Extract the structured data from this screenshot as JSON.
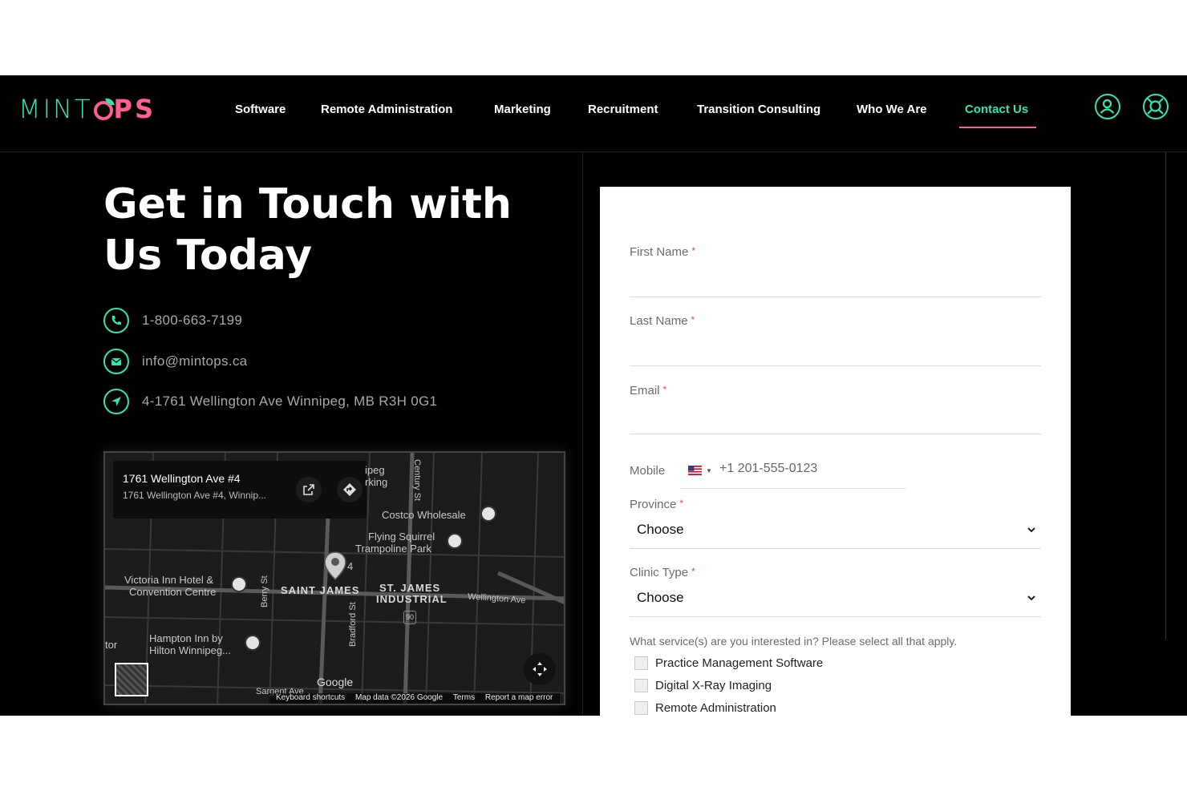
{
  "brand": {
    "logo_mint": "MINT",
    "logo_ops": "PS",
    "mint_color": "#2ee6b0",
    "pink_color": "#ff5f8f"
  },
  "nav": {
    "items": [
      {
        "label": "Software"
      },
      {
        "label": "Remote Administration"
      },
      {
        "label": "Marketing"
      },
      {
        "label": "Recruitment"
      },
      {
        "label": "Transition Consulting"
      },
      {
        "label": "Who We Are"
      },
      {
        "label": "Contact Us",
        "active": true
      }
    ],
    "icons": [
      "user-circle-icon",
      "lifebuoy-icon"
    ]
  },
  "hero": {
    "title": "Get in Touch with Us Today"
  },
  "contact": {
    "phone": "1-800-663-7199",
    "email": "info@mintops.ca",
    "address": "4-1761 Wellington Ave Winnipeg, MB R3H 0G1"
  },
  "map": {
    "card_title": "1761 Wellington Ave #4",
    "card_subtitle": "1761 Wellington Ave #4, Winnip...",
    "labels": {
      "costco": "Costco Wholesale",
      "flying_squirrel_1": "Flying Squirrel",
      "flying_squirrel_2": "Trampoline Park",
      "victoria_1": "Victoria Inn Hotel &",
      "victoria_2": "Convention Centre",
      "hampton_1": "Hampton Inn by",
      "hampton_2": "Hilton Winnipeg...",
      "saint_james": "SAINT JAMES",
      "st_james_1": "ST. JAMES",
      "st_james_2": "INDUSTRIAL",
      "wellington": "Wellington Ave",
      "berry": "Berry St",
      "bradford": "Bradford St",
      "century": "Century St",
      "sargent": "Sargent Ave",
      "ipeg_1": "ipeg",
      "ipeg_2": "rking",
      "tor": "tor",
      "route": "90",
      "pin_num": "4"
    },
    "google": "Google",
    "footer": {
      "shortcuts": "Keyboard shortcuts",
      "data": "Map data ©2026 Google",
      "terms": "Terms",
      "report": "Report a map error"
    }
  },
  "form": {
    "first_name": {
      "label": "First Name",
      "req": "*"
    },
    "last_name": {
      "label": "Last Name",
      "req": "*"
    },
    "email": {
      "label": "Email",
      "req": "*"
    },
    "mobile": {
      "label": "Mobile",
      "placeholder": "+1 201-555-0123"
    },
    "province": {
      "label": "Province",
      "req": "*",
      "value": "Choose"
    },
    "clinic_type": {
      "label": "Clinic Type",
      "req": "*",
      "value": "Choose"
    },
    "services_question": "What service(s) are you interested in? Please select all that apply.",
    "services": [
      {
        "label": "Practice Management Software"
      },
      {
        "label": "Digital X-Ray Imaging"
      },
      {
        "label": "Remote Administration"
      }
    ]
  }
}
